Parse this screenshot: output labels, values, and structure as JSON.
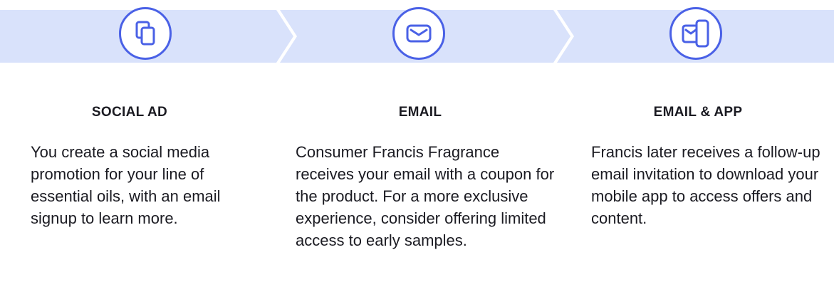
{
  "colors": {
    "band": "#d9e2fb",
    "accent": "#4a61e6",
    "text": "#1b1b22"
  },
  "steps": [
    {
      "icon": "copy-icon",
      "title": "SOCIAL AD",
      "text": "You create a social media promotion for your line of essential oils, with an email signup to learn more."
    },
    {
      "icon": "envelope-icon",
      "title": "EMAIL",
      "text": "Consumer Francis Fragrance receives your email with a coupon for the product. For a more exclusive experience, consider offering limited access to early samples."
    },
    {
      "icon": "email-and-phone-icon",
      "title": "EMAIL & APP",
      "text": "Francis later receives a follow-up email invitation to download your mobile app to access offers and content."
    }
  ]
}
